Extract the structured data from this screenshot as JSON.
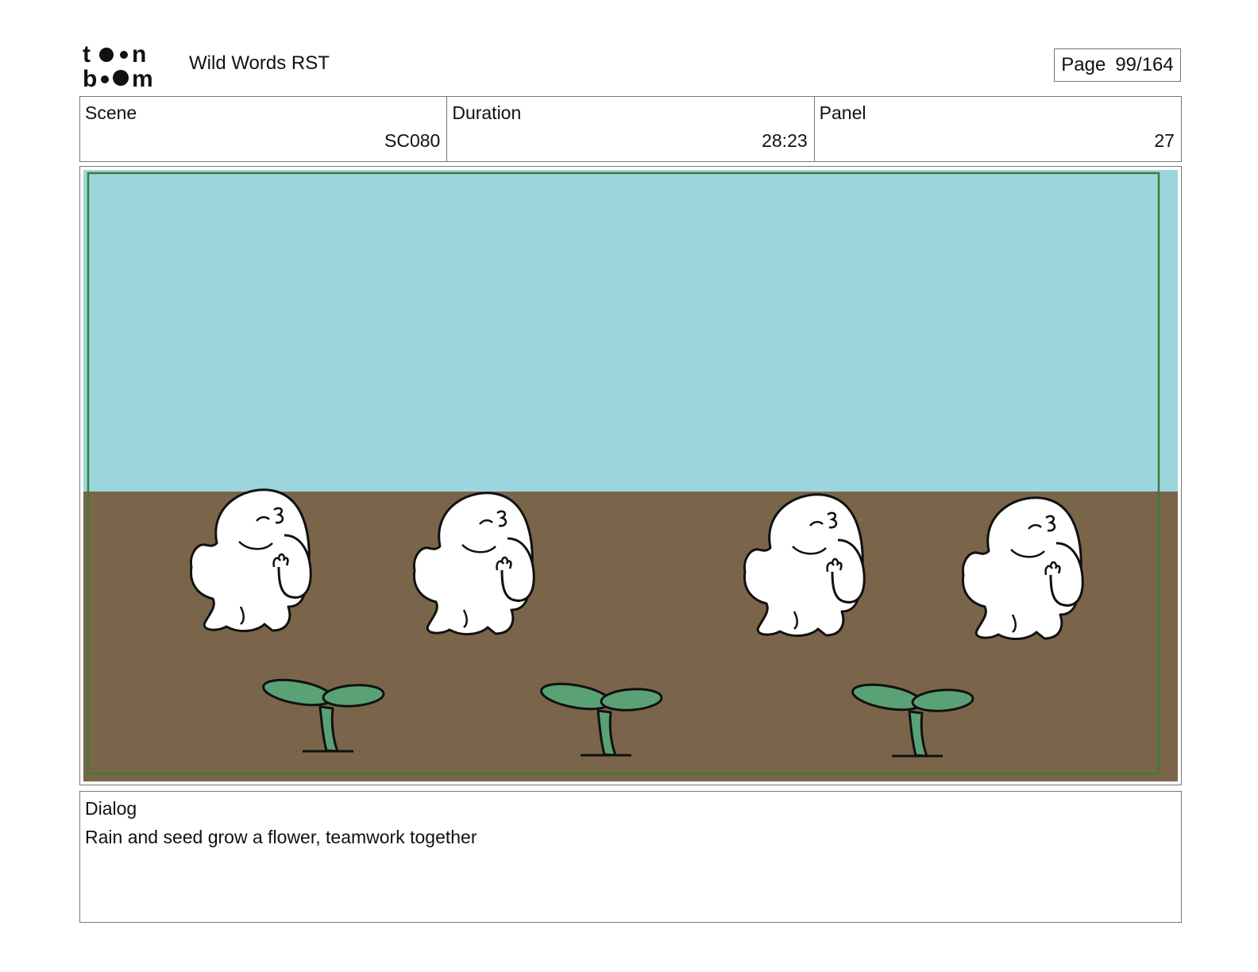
{
  "header": {
    "logo_text_top": "toon",
    "logo_text_bottom": "boom",
    "title": "Wild Words RST",
    "page_label": "Page",
    "page_value": "99/164"
  },
  "meta": {
    "scene_label": "Scene",
    "scene_value": "SC080",
    "duration_label": "Duration",
    "duration_value": "28:23",
    "panel_label": "Panel",
    "panel_value": "27"
  },
  "panel_colors": {
    "sky": "#9dd5df",
    "ground": "#7b654a",
    "safe_frame": "#3d7d33",
    "sprout": "#5aa276",
    "character": "#ffffff"
  },
  "dialog": {
    "label": "Dialog",
    "text": "Rain and seed grow a flower, teamwork together"
  }
}
